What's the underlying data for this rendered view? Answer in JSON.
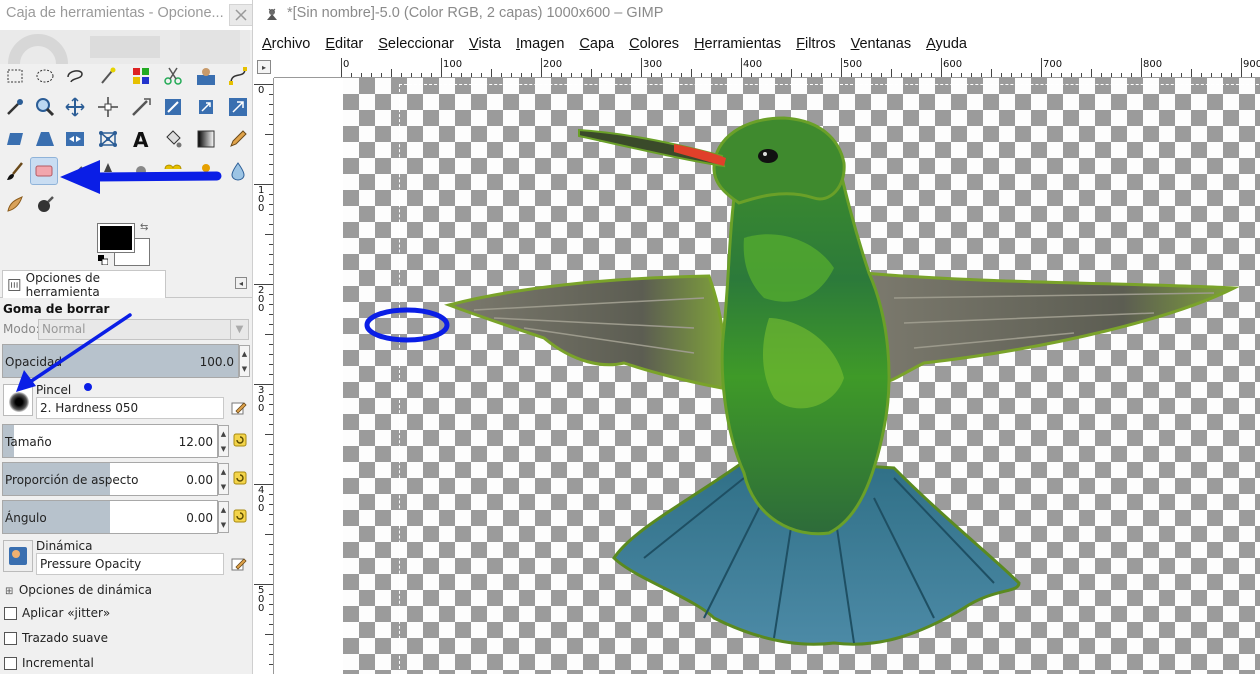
{
  "toolbox": {
    "title": "Caja de herramientas - Opcione...",
    "tools_row1": [
      "rect-select-icon",
      "ellipse-select-icon",
      "free-select-icon",
      "fuzzy-select-icon",
      "select-by-color-icon",
      "scissors-icon",
      "foreground-select-icon",
      "paths-icon"
    ],
    "tools_row2": [
      "color-picker-icon",
      "zoom-icon",
      "measure-icon",
      "move-icon",
      "align-icon",
      "crop-icon",
      "rotate-icon",
      "scale-icon"
    ],
    "tools_row3": [
      "shear-icon",
      "perspective-icon",
      "flip-icon",
      "cage-icon",
      "text-icon",
      "bucket-fill-icon",
      "blend-icon",
      "pencil-icon"
    ],
    "tools_row4": [
      "paintbrush-icon",
      "eraser-icon",
      "airbrush-icon",
      "ink-icon",
      "clone-icon",
      "heal-icon",
      "perspective-clone-icon",
      "blur-icon"
    ],
    "tools_row5": [
      "smudge-icon",
      "dodge-burn-icon"
    ],
    "fg_color": "#000000",
    "bg_color": "#ffffff"
  },
  "tool_options": {
    "tab_label": "Opciones de herramienta",
    "title": "Goma de borrar",
    "mode_label": "Modo:",
    "mode_value": "Normal",
    "opacity_label": "Opacidad",
    "opacity_value": "100.0",
    "opacity_fraction": 1.0,
    "brush_label": "Pincel",
    "brush_value": "2. Hardness 050",
    "size_label": "Tamaño",
    "size_value": "12.00",
    "size_fraction": 0.05,
    "aspect_label": "Proporción de aspecto",
    "aspect_value": "0.00",
    "aspect_fraction": 0.5,
    "angle_label": "Ángulo",
    "angle_value": "0.00",
    "angle_fraction": 0.5,
    "dynamics_label": "Dinámica",
    "dynamics_value": "Pressure Opacity",
    "dynamics_options_label": "Opciones de dinámica",
    "jitter_label": "Aplicar «jitter»",
    "smooth_label": "Trazado suave",
    "incremental_label": "Incremental"
  },
  "image_window": {
    "title": "*[Sin nombre]-5.0 (Color RGB, 2 capas) 1000x600 – GIMP",
    "menus": [
      {
        "label": "Archivo",
        "key": "A"
      },
      {
        "label": "Editar",
        "key": "E"
      },
      {
        "label": "Seleccionar",
        "key": "S"
      },
      {
        "label": "Vista",
        "key": "V"
      },
      {
        "label": "Imagen",
        "key": "I"
      },
      {
        "label": "Capa",
        "key": "C"
      },
      {
        "label": "Colores",
        "key": "C"
      },
      {
        "label": "Herramientas",
        "key": "H"
      },
      {
        "label": "Filtros",
        "key": "F"
      },
      {
        "label": "Ventanas",
        "key": "V"
      },
      {
        "label": "Ayuda",
        "key": "A"
      }
    ],
    "hruler_labels": [
      "0",
      "100",
      "200",
      "300",
      "400",
      "500",
      "600",
      "700",
      "800",
      "900"
    ],
    "vruler_labels": [
      "0",
      "100",
      "200",
      "300",
      "400",
      "500"
    ]
  },
  "annotation_color": "#0a1ee6"
}
